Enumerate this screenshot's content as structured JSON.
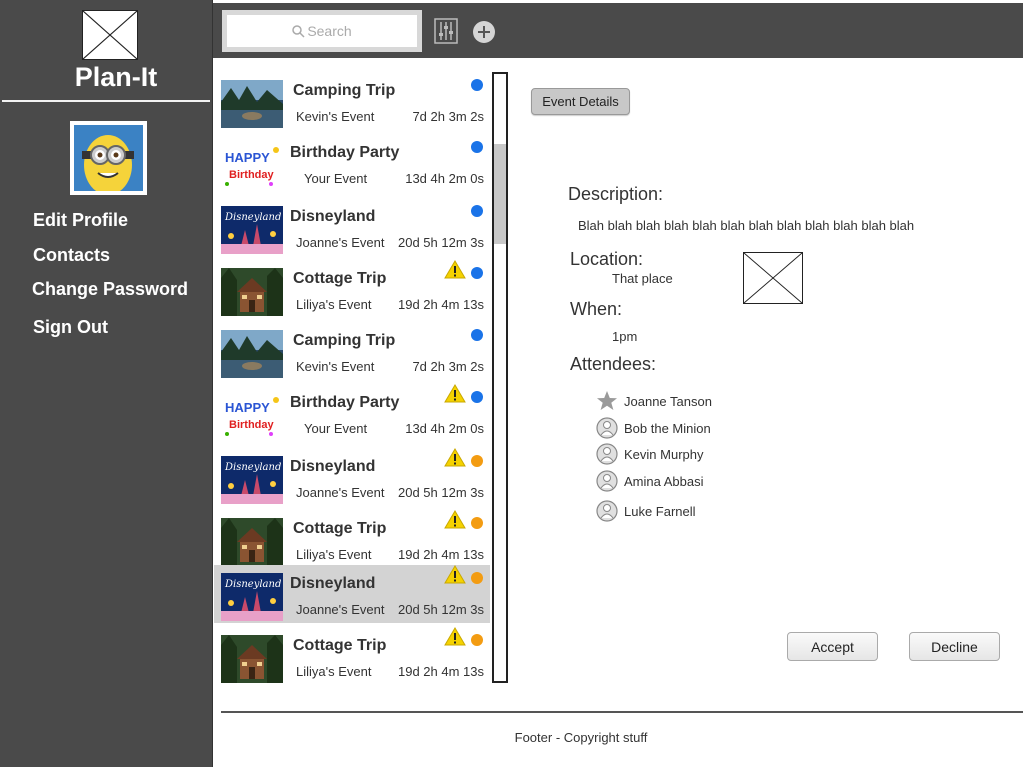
{
  "app": {
    "title": "Plan-It"
  },
  "sidebar": {
    "items": [
      {
        "label": "Edit Profile"
      },
      {
        "label": "Contacts"
      },
      {
        "label": "Change Password"
      },
      {
        "label": "Sign Out"
      }
    ]
  },
  "search": {
    "placeholder": "Search"
  },
  "events": [
    {
      "title": "Camping Trip",
      "owner": "Kevin's Event",
      "time": "7d 2h 3m 2s",
      "status": "blue",
      "warning": false,
      "thumb": "camping"
    },
    {
      "title": "Birthday Party",
      "owner": "Your Event",
      "time": "13d 4h 2m 0s",
      "status": "blue",
      "warning": false,
      "thumb": "birthday"
    },
    {
      "title": "Disneyland",
      "owner": "Joanne's Event",
      "time": "20d 5h 12m 3s",
      "status": "blue",
      "warning": false,
      "thumb": "disney"
    },
    {
      "title": "Cottage Trip",
      "owner": "Liliya's Event",
      "time": "19d 2h 4m 13s",
      "status": "blue",
      "warning": true,
      "thumb": "cottage"
    },
    {
      "title": "Camping Trip",
      "owner": "Kevin's Event",
      "time": "7d 2h 3m 2s",
      "status": "blue",
      "warning": false,
      "thumb": "camping"
    },
    {
      "title": "Birthday Party",
      "owner": "Your Event",
      "time": "13d 4h 2m 0s",
      "status": "blue",
      "warning": true,
      "thumb": "birthday"
    },
    {
      "title": "Disneyland",
      "owner": "Joanne's Event",
      "time": "20d 5h 12m 3s",
      "status": "orange",
      "warning": true,
      "thumb": "disney"
    },
    {
      "title": "Cottage Trip",
      "owner": "Liliya's Event",
      "time": "19d 2h 4m 13s",
      "status": "orange",
      "warning": true,
      "thumb": "cottage"
    },
    {
      "title": "Disneyland",
      "owner": "Joanne's Event",
      "time": "20d 5h 12m 3s",
      "status": "orange",
      "warning": true,
      "thumb": "disney",
      "selected": true
    },
    {
      "title": "Cottage Trip",
      "owner": "Liliya's Event",
      "time": "19d 2h 4m 13s",
      "status": "orange",
      "warning": true,
      "thumb": "cottage"
    }
  ],
  "details": {
    "button_label": "Event Details",
    "description_label": "Description:",
    "description": "Blah blah blah blah blah blah blah blah blah blah blah blah",
    "location_label": "Location:",
    "location": "That place",
    "when_label": "When:",
    "when": "1pm",
    "attendees_label": "Attendees:",
    "attendees": [
      {
        "name": "Joanne Tanson",
        "icon": "star-icon"
      },
      {
        "name": "Bob the Minion",
        "icon": "user-icon"
      },
      {
        "name": "Kevin Murphy",
        "icon": "user-icon"
      },
      {
        "name": "Amina Abbasi",
        "icon": "user-icon"
      },
      {
        "name": "Luke Farnell",
        "icon": "user-icon"
      }
    ]
  },
  "actions": {
    "accept": "Accept",
    "decline": "Decline"
  },
  "footer": {
    "text": "Footer - Copyright stuff"
  },
  "colors": {
    "sidebar_bg": "#4a4a4a",
    "status_blue": "#1a73e8",
    "status_orange": "#f39c12",
    "selected_row": "#d3d3d3"
  }
}
